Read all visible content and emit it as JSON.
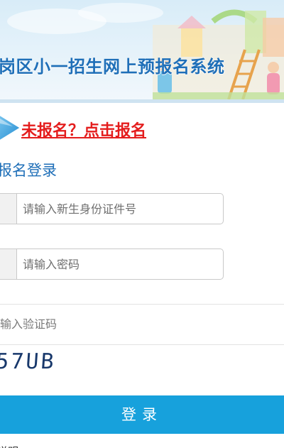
{
  "banner": {
    "title": "岗区小一招生网上预报名系统"
  },
  "register_link": {
    "label": "未报名？点击报名"
  },
  "login": {
    "heading": "报名登录",
    "id_placeholder": "请输入新生身份证件号",
    "password_placeholder": "请输入密码",
    "captcha_placeholder": "输入验证码",
    "captcha_text": "57UB",
    "submit_label": "登录"
  },
  "footer": {
    "cut_text": "说明"
  },
  "colors": {
    "brand_blue": "#1f6fb8",
    "button_blue": "#17a1dc",
    "link_red": "#e41d1d"
  },
  "icons": [
    "arrow-right-icon"
  ]
}
